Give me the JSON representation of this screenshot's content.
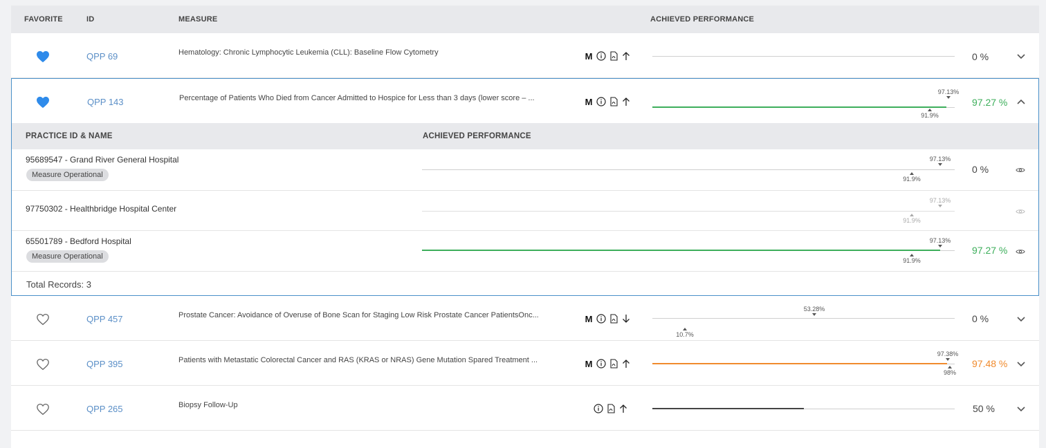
{
  "header": {
    "favorite": "FAVORITE",
    "id": "ID",
    "measure": "MEASURE",
    "achieved": "ACHIEVED PERFORMANCE"
  },
  "colors": {
    "link": "#5b8fc7",
    "green": "#3cae5a",
    "orange": "#f08a2c",
    "favorite": "#2f8bea",
    "accent_border": "#4a90c9"
  },
  "measures": [
    {
      "favorite": true,
      "id": "QPP 69",
      "title": "Hematology: Chronic Lymphocytic Leukemia (CLL): Baseline Flow Cytometry",
      "badge_m": "M",
      "value": "0 %",
      "direction": "up"
    },
    {
      "favorite": true,
      "id": "QPP 143",
      "title": "Percentage of Patients Who Died from Cancer Admitted to Hospice for Less than 3 days (lower score – ...",
      "badge_m": "M",
      "benchmark_top": "97.13%",
      "benchmark_bottom": "91.9%",
      "value": "97.27 %",
      "value_fraction": 0.9727,
      "direction": "up",
      "expanded": true
    },
    {
      "favorite": false,
      "id": "QPP 457",
      "title": "Prostate Cancer: Avoidance of Overuse of Bone Scan for Staging Low Risk Prostate Cancer PatientsOnc...",
      "badge_m": "M",
      "benchmark_top": "53.28%",
      "benchmark_bottom": "10.7%",
      "value": "0 %",
      "direction": "down"
    },
    {
      "favorite": false,
      "id": "QPP 395",
      "title": "Patients with Metastatic Colorectal Cancer and RAS (KRAS or NRAS) Gene Mutation Spared Treatment ...",
      "badge_m": "M",
      "benchmark_top": "97.38%",
      "benchmark_bottom": "98%",
      "value": "97.48 %",
      "value_fraction": 0.9748,
      "direction": "up"
    },
    {
      "favorite": false,
      "id": "QPP 265",
      "title": "Biopsy Follow-Up",
      "value": "50 %",
      "value_fraction": 0.5,
      "direction": "up"
    }
  ],
  "practices": {
    "header_name": "PRACTICE ID & NAME",
    "header_achieved": "ACHIEVED PERFORMANCE",
    "rows": [
      {
        "name": "95689547 - Grand River General Hospital",
        "tag": "Measure Operational",
        "benchmark_top": "97.13%",
        "benchmark_bottom": "91.9%",
        "value": "0 %"
      },
      {
        "name": "97750302 - Healthbridge Hospital Center",
        "benchmark_top": "97.13%",
        "benchmark_bottom": "91.9%"
      },
      {
        "name": "65501789 - Bedford Hospital",
        "tag": "Measure Operational",
        "benchmark_top": "97.13%",
        "benchmark_bottom": "91.9%",
        "value": "97.27 %",
        "value_fraction": 0.9727
      }
    ],
    "total": "Total Records: 3"
  }
}
